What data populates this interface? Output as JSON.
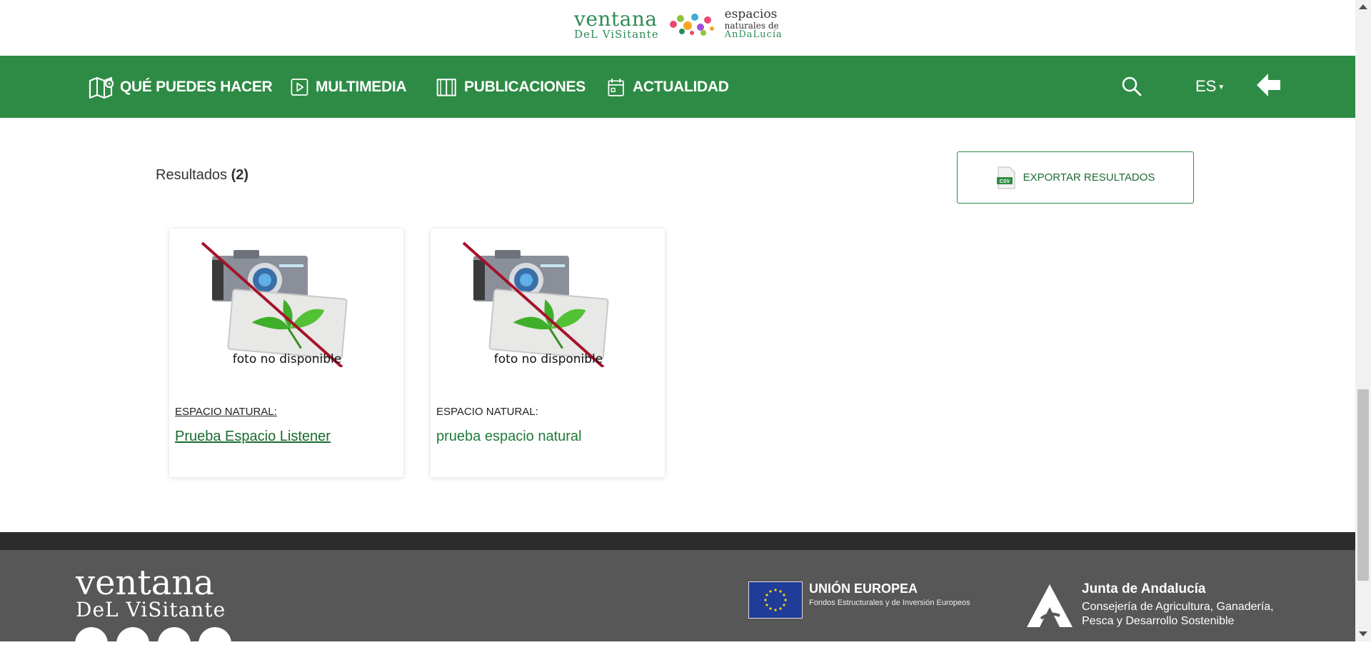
{
  "header": {
    "logo_ventana_line1": "ventana",
    "logo_ventana_line2": "DeL ViSitante",
    "logo_espacios_line1": "espacios",
    "logo_espacios_line2": "naturales de",
    "logo_espacios_line3": "AnDaLucía"
  },
  "nav": {
    "items": [
      {
        "label": "QUÉ PUEDES HACER",
        "icon": "map-pin-icon"
      },
      {
        "label": "MULTIMEDIA",
        "icon": "play-icon"
      },
      {
        "label": "PUBLICACIONES",
        "icon": "book-icon"
      },
      {
        "label": "ACTUALIDAD",
        "icon": "calendar-icon"
      }
    ],
    "search_icon": "search-icon",
    "language": "ES",
    "back_icon": "arrow-left-icon"
  },
  "results": {
    "label": "Resultados",
    "count": "(2)",
    "export_label": "EXPORTAR RESULTADOS",
    "export_icon_text": "CSV",
    "cards": [
      {
        "image_caption": "foto no disponible",
        "kind": "ESPACIO NATURAL:",
        "title": "Prueba Espacio Listener"
      },
      {
        "image_caption": "foto no disponible",
        "kind": "ESPACIO NATURAL:",
        "title": "prueba espacio natural"
      }
    ]
  },
  "footer": {
    "logo_line1": "ventana",
    "logo_line2": "DeL ViSitante",
    "eu_title": "UNIÓN EUROPEA",
    "eu_subtitle": "Fondos Estructurales y de Inversión Europeos",
    "junta_title": "Junta de Andalucía",
    "junta_subtitle": "Consejería de Agricultura, Ganadería, Pesca y Desarrollo Sostenible",
    "social": [
      "twitter-icon",
      "facebook-icon",
      "instagram-icon",
      "pinterest-icon"
    ]
  },
  "colors": {
    "nav_green": "#2e8b45",
    "link_green": "#1f7a38",
    "footer_gray": "#575757",
    "footer_dark": "#2c2c2c"
  }
}
